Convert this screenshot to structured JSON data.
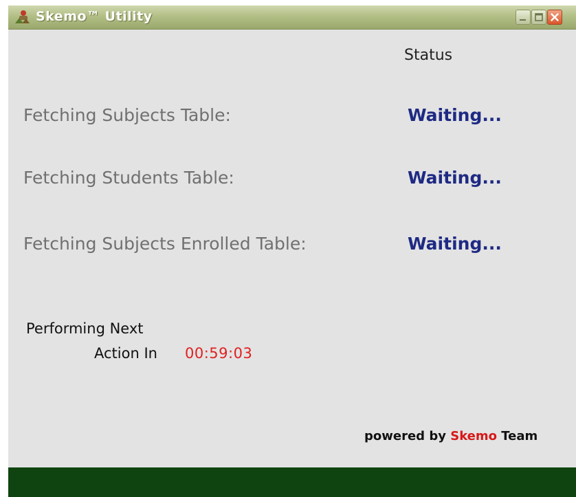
{
  "window": {
    "title": "Skemo™ Utility",
    "icon": "app-logo-icon"
  },
  "controls": {
    "minimize_icon": "minimize-icon",
    "maximize_icon": "maximize-icon",
    "close_icon": "close-icon"
  },
  "status_header": "Status",
  "tasks": [
    {
      "label": "Fetching Subjects Table:",
      "status": "Waiting..."
    },
    {
      "label": "Fetching Students Table:",
      "status": "Waiting..."
    },
    {
      "label": "Fetching Subjects Enrolled Table:",
      "status": "Waiting..."
    }
  ],
  "next_action": {
    "line1": "Performing Next",
    "line2": "Action In",
    "countdown": "00:59:03"
  },
  "footer": {
    "powered_prefix": "powered by",
    "brand": "Skemo",
    "suffix": "Team"
  },
  "colors": {
    "titlebar": "#b2bf86",
    "status_text": "#1e2a83",
    "countdown": "#e02020",
    "brand": "#d81818",
    "footer_bar": "#0f4410"
  }
}
